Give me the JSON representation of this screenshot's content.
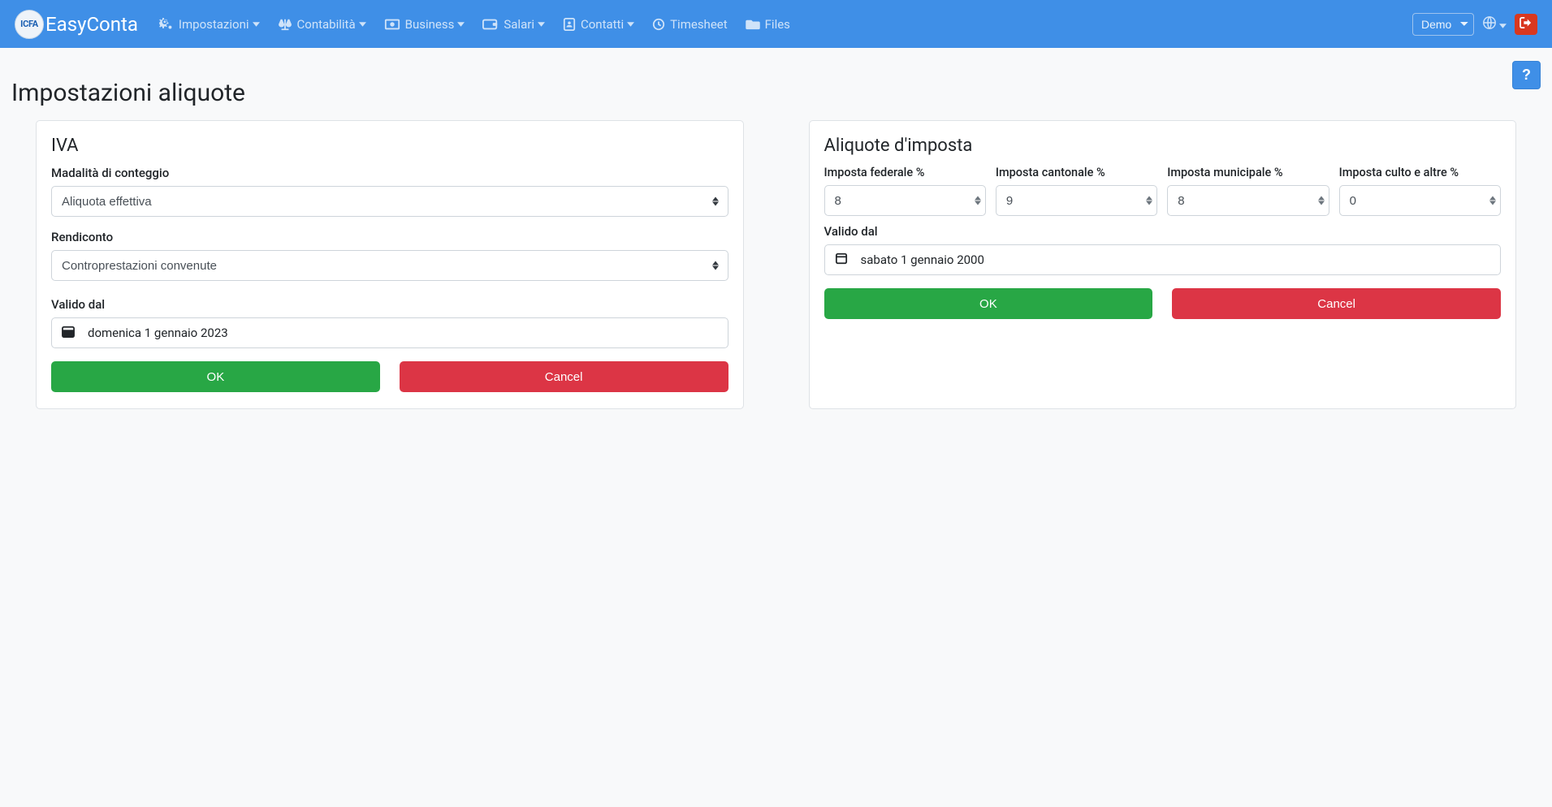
{
  "brand": {
    "logo": "ICFA",
    "name": "EasyConta"
  },
  "nav": {
    "items": [
      {
        "label": "Impostazioni",
        "hasCaret": true
      },
      {
        "label": "Contabilità",
        "hasCaret": true
      },
      {
        "label": "Business",
        "hasCaret": true
      },
      {
        "label": "Salari",
        "hasCaret": true
      },
      {
        "label": "Contatti",
        "hasCaret": true
      },
      {
        "label": "Timesheet",
        "hasCaret": false
      },
      {
        "label": "Files",
        "hasCaret": false
      }
    ]
  },
  "topRight": {
    "demo": "Demo"
  },
  "helpLabel": "?",
  "page": {
    "title": "Impostazioni aliquote"
  },
  "iva": {
    "title": "IVA",
    "modeLabel": "Madalità di conteggio",
    "modeValue": "Aliquota effettiva",
    "reportLabel": "Rendiconto",
    "reportValue": "Controprestazioni convenute",
    "validLabel": "Valido dal",
    "validValue": "domenica 1 gennaio 2023",
    "okLabel": "OK",
    "cancelLabel": "Cancel"
  },
  "tax": {
    "title": "Aliquote d'imposta",
    "federalLabel": "Imposta federale %",
    "federalValue": "8",
    "cantonalLabel": "Imposta cantonale %",
    "cantonalValue": "9",
    "municipalLabel": "Imposta municipale %",
    "municipalValue": "8",
    "cultLabel": "Imposta culto e altre %",
    "cultValue": "0",
    "validLabel": "Valido dal",
    "validValue": "sabato 1 gennaio 2000",
    "okLabel": "OK",
    "cancelLabel": "Cancel"
  }
}
